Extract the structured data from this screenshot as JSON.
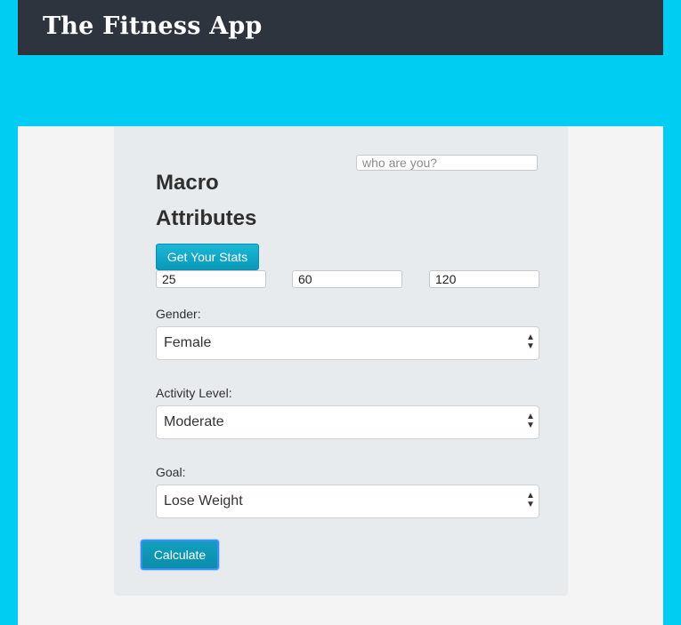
{
  "navbar": {
    "brand": "The Fitness App"
  },
  "form": {
    "title": "Macro Attributes",
    "identity_placeholder": "who are you?",
    "stats_button": "Get Your Stats",
    "stat_values": [
      "25",
      "60",
      "120"
    ],
    "gender": {
      "label": "Gender:",
      "value": "Female"
    },
    "activity": {
      "label": "Activity Level:",
      "value": "Moderate"
    },
    "goal": {
      "label": "Goal:",
      "value": "Lose Weight"
    },
    "calculate_button": "Calculate"
  },
  "icons": {
    "select_arrows": "up-down-chevrons-icon"
  },
  "colors": {
    "background": "#00cdf2",
    "navbar": "#2e343e",
    "card": "#e8ebee",
    "button": "#0a98ba"
  }
}
